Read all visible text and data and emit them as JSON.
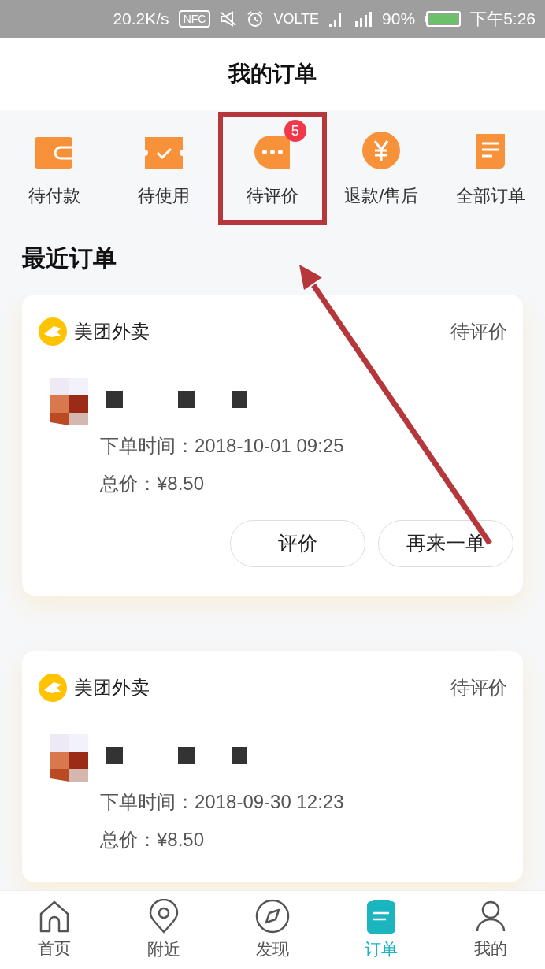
{
  "status_bar": {
    "speed": "20.2K/s",
    "nfc": "NFC",
    "volte": "VOLTE",
    "battery": "90%",
    "time": "下午5:26"
  },
  "header": {
    "title": "我的订单"
  },
  "categories": [
    {
      "kind": "wallet",
      "label": "待付款",
      "highlighted": false
    },
    {
      "kind": "ticket",
      "label": "待使用",
      "highlighted": false
    },
    {
      "kind": "chat",
      "label": "待评价",
      "badge": "5",
      "highlighted": true
    },
    {
      "kind": "yen",
      "label": "退款/售后",
      "highlighted": false
    },
    {
      "kind": "list",
      "label": "全部订单",
      "highlighted": false
    }
  ],
  "section_title": "最近订单",
  "orders": [
    {
      "shop": "美团外卖",
      "status": "待评价",
      "time": "下单时间：2018-10-01 09:25",
      "total": "总价：¥8.50",
      "buttons": [
        "评价",
        "再来一单"
      ]
    },
    {
      "shop": "美团外卖",
      "status": "待评价",
      "time": "下单时间：2018-09-30 12:23",
      "total": "总价：¥8.50"
    }
  ],
  "nav": [
    {
      "kind": "home",
      "label": "首页",
      "selected": false
    },
    {
      "kind": "pin",
      "label": "附近",
      "selected": false
    },
    {
      "kind": "compass",
      "label": "发现",
      "selected": false
    },
    {
      "kind": "orders",
      "label": "订单",
      "selected": true
    },
    {
      "kind": "person",
      "label": "我的",
      "selected": false
    }
  ]
}
